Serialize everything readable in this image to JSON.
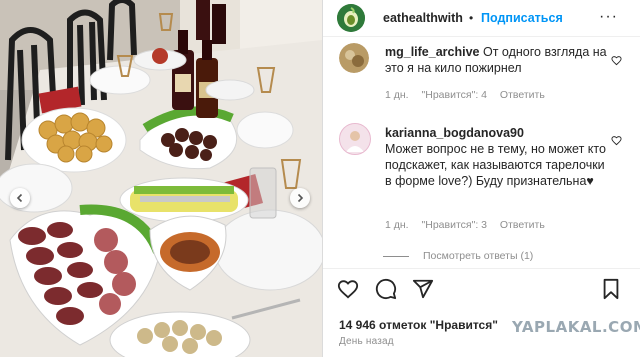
{
  "post": {
    "username": "eathealthwith",
    "separator": "•",
    "follow_label": "Подписаться",
    "more_label": "···"
  },
  "comments": [
    {
      "username": "mg_life_archive",
      "text": "От одного взгляда на это я на кило пожирнел",
      "time": "1 дн.",
      "likes": "\"Нравится\": 4",
      "reply": "Ответить"
    },
    {
      "username": "karianna_bogdanova90",
      "text": "Может вопрос не в тему, но может кто подскажет, как называются тарелочки в форме love?) Буду признательна",
      "emoji": "♥",
      "time": "1 дн.",
      "likes": "\"Нравится\": 3",
      "reply": "Ответить"
    }
  ],
  "view_replies": "Посмотреть ответы (1)",
  "likes_count": "14 946 отметок \"Нравится\"",
  "date": "День назад",
  "watermark": "YAPLAKAL.COM",
  "colors": {
    "link_blue": "#0095f6",
    "text": "#262626",
    "muted": "#8e8e8e"
  },
  "icons": [
    "leaf-logo-icon",
    "heart-icon",
    "comment-icon",
    "share-icon",
    "bookmark-icon",
    "chevron-left-icon",
    "chevron-right-icon"
  ]
}
